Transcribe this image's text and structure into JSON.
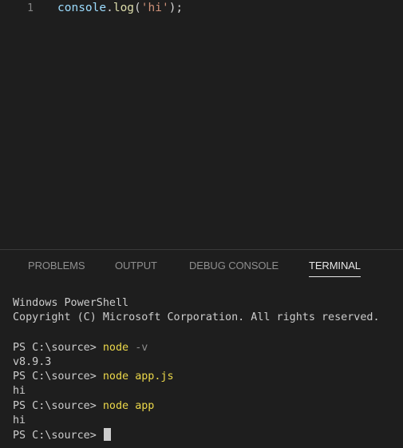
{
  "editor": {
    "line_number": "1",
    "code": {
      "object": "console",
      "dot": ".",
      "method": "log",
      "open": "(",
      "string": "'hi'",
      "close": ");"
    }
  },
  "panel": {
    "tabs": [
      "PROBLEMS",
      "OUTPUT",
      "DEBUG CONSOLE",
      "TERMINAL"
    ],
    "active_tab": "TERMINAL"
  },
  "terminal": {
    "header": "Windows PowerShell",
    "copyright": "Copyright (C) Microsoft Corporation. All rights reserved.",
    "prompt": "PS C:\\source> ",
    "commands": [
      {
        "cmd": "node",
        "args": "-v",
        "output": "v8.9.3"
      },
      {
        "cmd": "node",
        "args": "app.js",
        "output": "hi"
      },
      {
        "cmd": "node",
        "args": "app",
        "output": "hi"
      }
    ]
  },
  "colors": {
    "background": "#1e1e1e",
    "command": "#ecd84a",
    "string": "#ce9178",
    "function": "#dcdcaa",
    "variable": "#9cdcfe"
  }
}
